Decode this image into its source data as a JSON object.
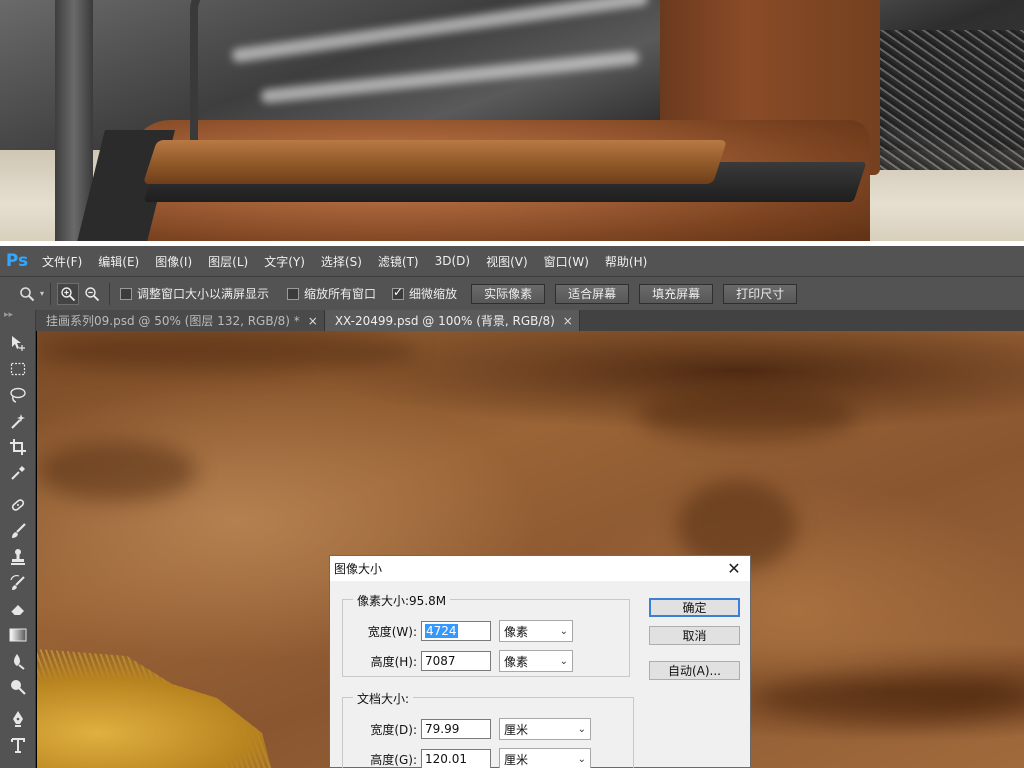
{
  "app": {
    "logo": "Ps"
  },
  "menu": [
    "文件(F)",
    "编辑(E)",
    "图像(I)",
    "图层(L)",
    "文字(Y)",
    "选择(S)",
    "滤镜(T)",
    "3D(D)",
    "视图(V)",
    "窗口(W)",
    "帮助(H)"
  ],
  "options": {
    "resize_windows": "调整窗口大小以满屏显示",
    "zoom_all_windows": "缩放所有窗口",
    "scrubby_zoom": "细微缩放",
    "scrubby_zoom_checked": true,
    "actual_pixels": "实际像素",
    "fit_screen": "适合屏幕",
    "fill_screen": "填充屏幕",
    "print_size": "打印尺寸"
  },
  "tabs": [
    {
      "label": "挂画系列09.psd @ 50% (图层 132, RGB/8) *",
      "close": "×"
    },
    {
      "label": "XX-20499.psd @ 100% (背景, RGB/8)",
      "close": "×"
    }
  ],
  "dialog": {
    "title": "图像大小",
    "close": "✕",
    "pixel_dimensions": {
      "legend": "像素大小:95.8M",
      "width_label": "宽度(W):",
      "width_value": "4724",
      "width_unit": "像素",
      "height_label": "高度(H):",
      "height_value": "7087",
      "height_unit": "像素"
    },
    "document_size": {
      "legend": "文档大小:",
      "width_label": "宽度(D):",
      "width_value": "79.99",
      "width_unit": "厘米",
      "height_label": "高度(G):",
      "height_value": "120.01",
      "height_unit": "厘米"
    },
    "buttons": {
      "ok": "确定",
      "cancel": "取消",
      "auto": "自动(A)..."
    }
  },
  "colors": {
    "ps_blue": "#31a8ff",
    "chrome": "#535353",
    "dialog_bg": "#f0f0f0",
    "selection": "#3399ff"
  }
}
